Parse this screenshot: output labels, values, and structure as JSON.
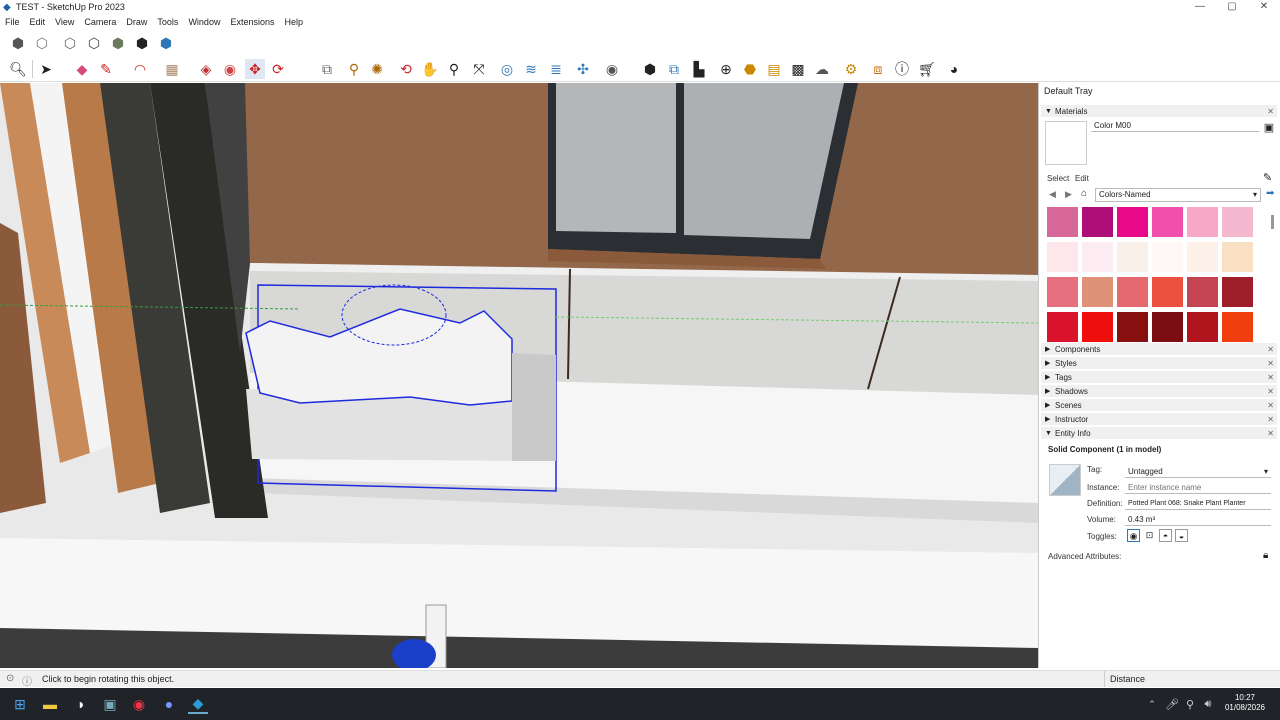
{
  "window": {
    "title": "TEST - SketchUp Pro 2023",
    "minimize": "—",
    "maximize": "▢",
    "close": "✕"
  },
  "menu": [
    "File",
    "Edit",
    "View",
    "Camera",
    "Draw",
    "Tools",
    "Window",
    "Extensions",
    "Help"
  ],
  "toolbar_icons": {
    "style_icons": [
      "xray-icon",
      "back-edges-icon",
      "wireframe-icon",
      "hidden-line-icon",
      "shaded-icon",
      "shaded-textures-icon",
      "monochrome-icon"
    ],
    "tools": [
      "search-icon",
      "select-icon",
      "eraser-icon",
      "line-icon",
      "arc-icon",
      "shape-icon",
      "push-pull-icon",
      "offset-icon",
      "move-icon",
      "rotate-icon",
      "scale-icon",
      "tape-icon",
      "paint-icon",
      "orbit-icon",
      "pan-icon",
      "zoom-icon",
      "zoom-extents-icon",
      "sections-icon",
      "sandbox-icon",
      "solid-tools-icon",
      "account-icon",
      "warehouse-icon",
      "extension-icon",
      "layout-icon",
      "add-icon",
      "styles-icon",
      "sandbox2-icon",
      "components-icon",
      "cloud-icon",
      "settings-icon",
      "scenes-icon",
      "info-icon",
      "cart-icon",
      "user-icon"
    ]
  },
  "tray": {
    "title": "Default Tray",
    "materials": {
      "header": "Materials",
      "color_name": "Color M00",
      "tab_select": "Select",
      "tab_edit": "Edit",
      "library": "Colors-Named",
      "swatches": [
        "#d9689a",
        "#ad0e78",
        "#e8098b",
        "#f04fae",
        "#f7a8c7",
        "#f4b9cf",
        "#fde7ea",
        "#fcebf0",
        "#faf0ea",
        "#fff8f6",
        "#fdf1ea",
        "#fae0c2",
        "#e6707e",
        "#e09278",
        "#e5696e",
        "#ec5140",
        "#c44453",
        "#9e1f2a",
        "#d8132b",
        "#ee0e0c",
        "#870f0f",
        "#7a0c12",
        "#b0151d",
        "#f03e0e"
      ]
    },
    "sections": [
      "Components",
      "Styles",
      "Tags",
      "Shadows",
      "Scenes",
      "Instructor",
      "Entity Info"
    ],
    "entity": {
      "title": "Solid Component (1 in model)",
      "tag_label": "Tag:",
      "tag_value": "Untagged",
      "instance_label": "Instance:",
      "instance_placeholder": "Enter instance name",
      "definition_label": "Definition:",
      "definition_value": "Potted Plant 068: Snake Plant Planter",
      "volume_label": "Volume:",
      "volume_value": "0.43 m³",
      "toggles_label": "Toggles:",
      "advanced": "Advanced Attributes:"
    }
  },
  "status": {
    "text": "Click to begin rotating this object.",
    "measure_label": "Distance"
  },
  "taskbar": {
    "time": "10:27",
    "date": "01/08/2026"
  }
}
